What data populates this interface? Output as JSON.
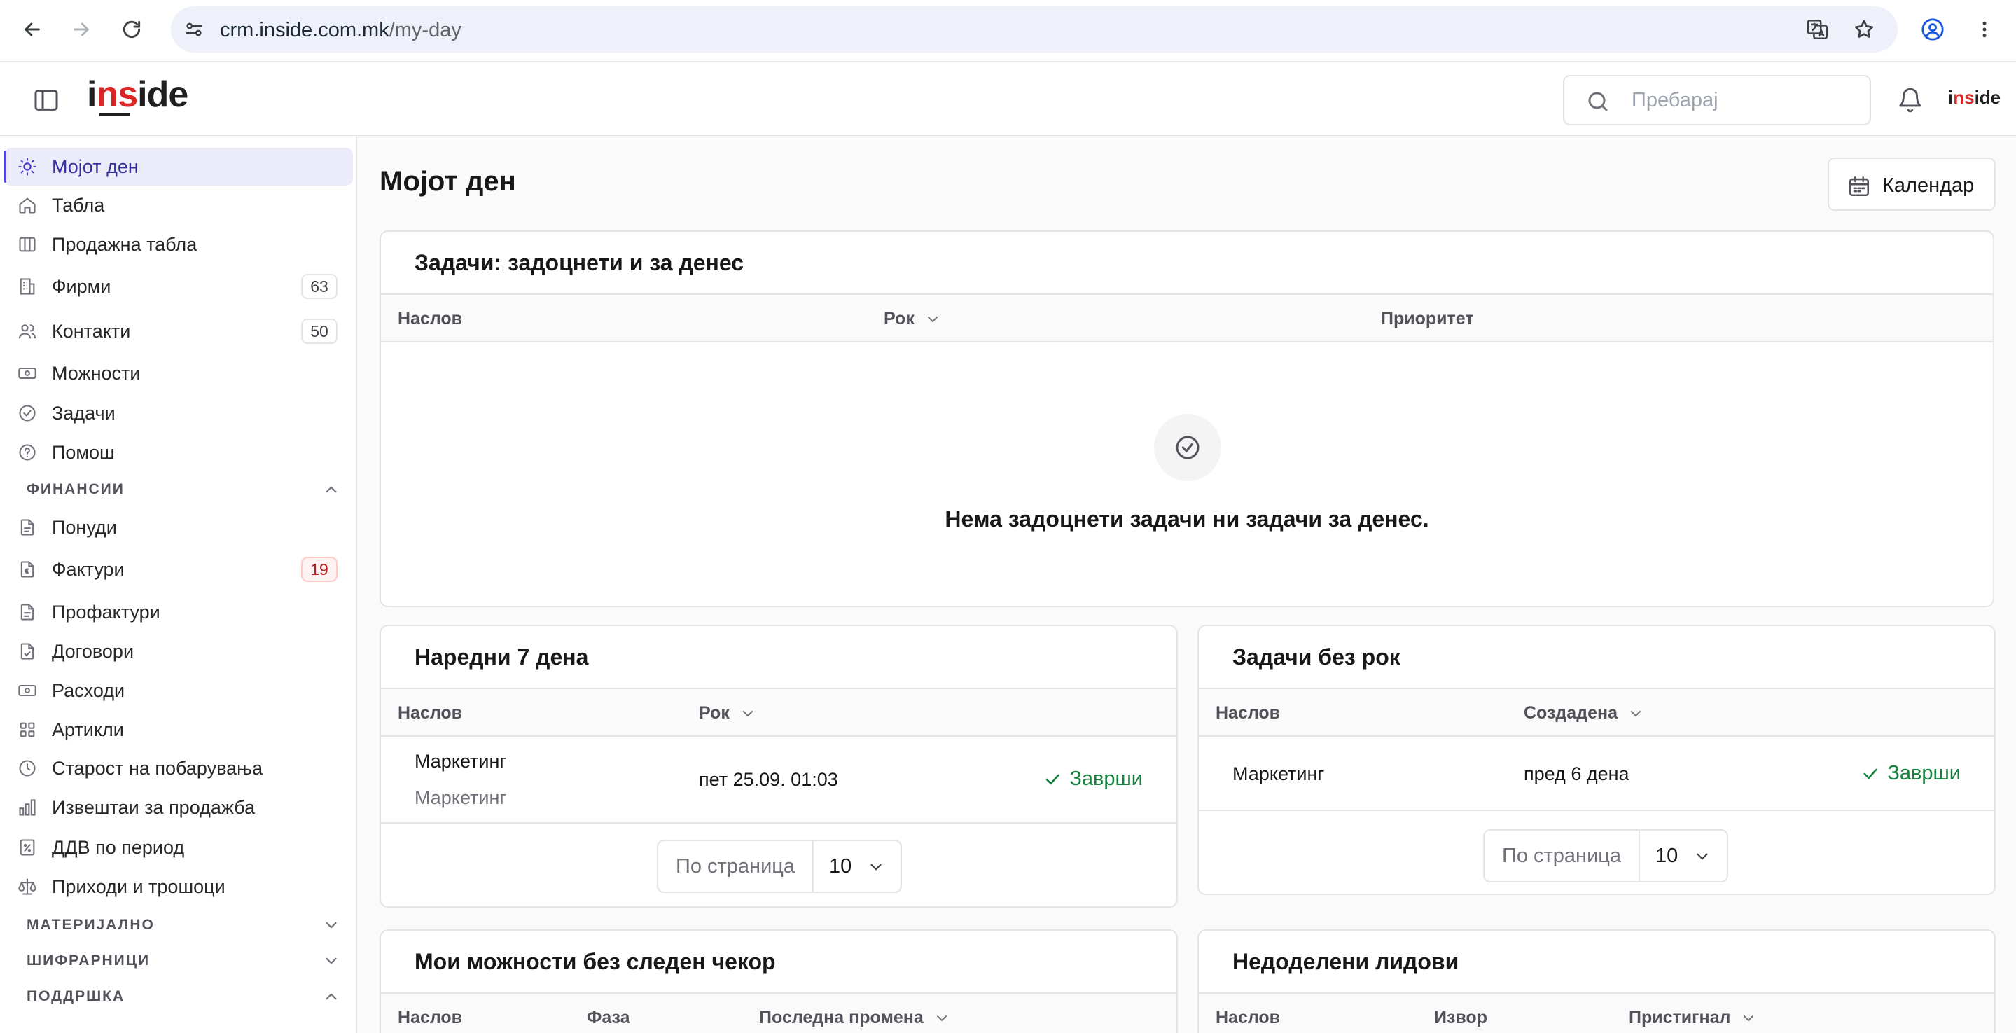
{
  "browser": {
    "url_host": "crm.inside.com.mk",
    "url_path": "/my-day"
  },
  "header": {
    "logo_text_1": "i",
    "logo_text_red": "ns",
    "logo_text_2": "ide",
    "search_placeholder": "Пребарај",
    "avatar_text_1": "i",
    "avatar_text_red": "ns",
    "avatar_text_2": "ide"
  },
  "sidebar": {
    "items": [
      {
        "label": "Мојот ден",
        "icon": "sun-icon"
      },
      {
        "label": "Табла",
        "icon": "home-icon"
      },
      {
        "label": "Продажна табла",
        "icon": "columns-icon"
      },
      {
        "label": "Фирми",
        "icon": "building-icon",
        "badge": "63"
      },
      {
        "label": "Контакти",
        "icon": "users-icon",
        "badge": "50"
      },
      {
        "label": "Можности",
        "icon": "banknote-icon"
      },
      {
        "label": "Задачи",
        "icon": "check-circle-icon"
      },
      {
        "label": "Помош",
        "icon": "help-circle-icon"
      }
    ],
    "sections": {
      "finance": "ФИНАНСИИ",
      "material": "МАТЕРИЈАЛНО",
      "codebooks": "ШИФРАРНИЦИ",
      "support": "ПОДДРШКА"
    },
    "finance_items": [
      {
        "label": "Понуди",
        "icon": "file-icon"
      },
      {
        "label": "Фактури",
        "icon": "invoice-icon",
        "badge": "19"
      },
      {
        "label": "Профактури",
        "icon": "file-icon"
      },
      {
        "label": "Договори",
        "icon": "file-check-icon"
      },
      {
        "label": "Расходи",
        "icon": "banknote-icon"
      },
      {
        "label": "Артикли",
        "icon": "grid-icon"
      },
      {
        "label": "Старост на побарувања",
        "icon": "clock-icon"
      },
      {
        "label": "Извештаи за продажба",
        "icon": "bar-chart-icon"
      },
      {
        "label": "ДДВ по период",
        "icon": "percent-icon"
      },
      {
        "label": "Приходи и трошоци",
        "icon": "scale-icon"
      }
    ]
  },
  "main": {
    "title": "Мојот ден",
    "calendar_button": "Календар",
    "overdue_card": {
      "title": "Задачи: задоцнети и за денес",
      "columns": [
        "Наслов",
        "Рок",
        "Приоритет"
      ],
      "empty_message": "Нема задоцнети задачи ни задачи за денес."
    },
    "next7_card": {
      "title": "Наредни 7 дена",
      "columns": [
        "Наслов",
        "Рок"
      ],
      "rows": [
        {
          "title": "Маркетинг",
          "subtitle": "Маркетинг",
          "due": "пет 25.09. 01:03",
          "action": "Заврши"
        }
      ],
      "per_page_label": "По страница",
      "per_page_value": "10"
    },
    "nodue_card": {
      "title": "Задачи без рок",
      "columns": [
        "Наслов",
        "Создадена"
      ],
      "rows": [
        {
          "title": "Маркетинг",
          "created": "пред 6 дена",
          "action": "Заврши"
        }
      ],
      "per_page_label": "По страница",
      "per_page_value": "10"
    },
    "opps_card": {
      "title": "Мои можности без следен чекор",
      "columns": [
        "Наслов",
        "Фаза",
        "Последна промена"
      ]
    },
    "leads_card": {
      "title": "Недоделени лидови",
      "columns": [
        "Наслов",
        "Извор",
        "Пристигнал"
      ]
    }
  },
  "colors": {
    "accent": "#4f46e5",
    "active_bg": "#ebebfa",
    "success": "#15803d",
    "danger": "#dc2626"
  }
}
